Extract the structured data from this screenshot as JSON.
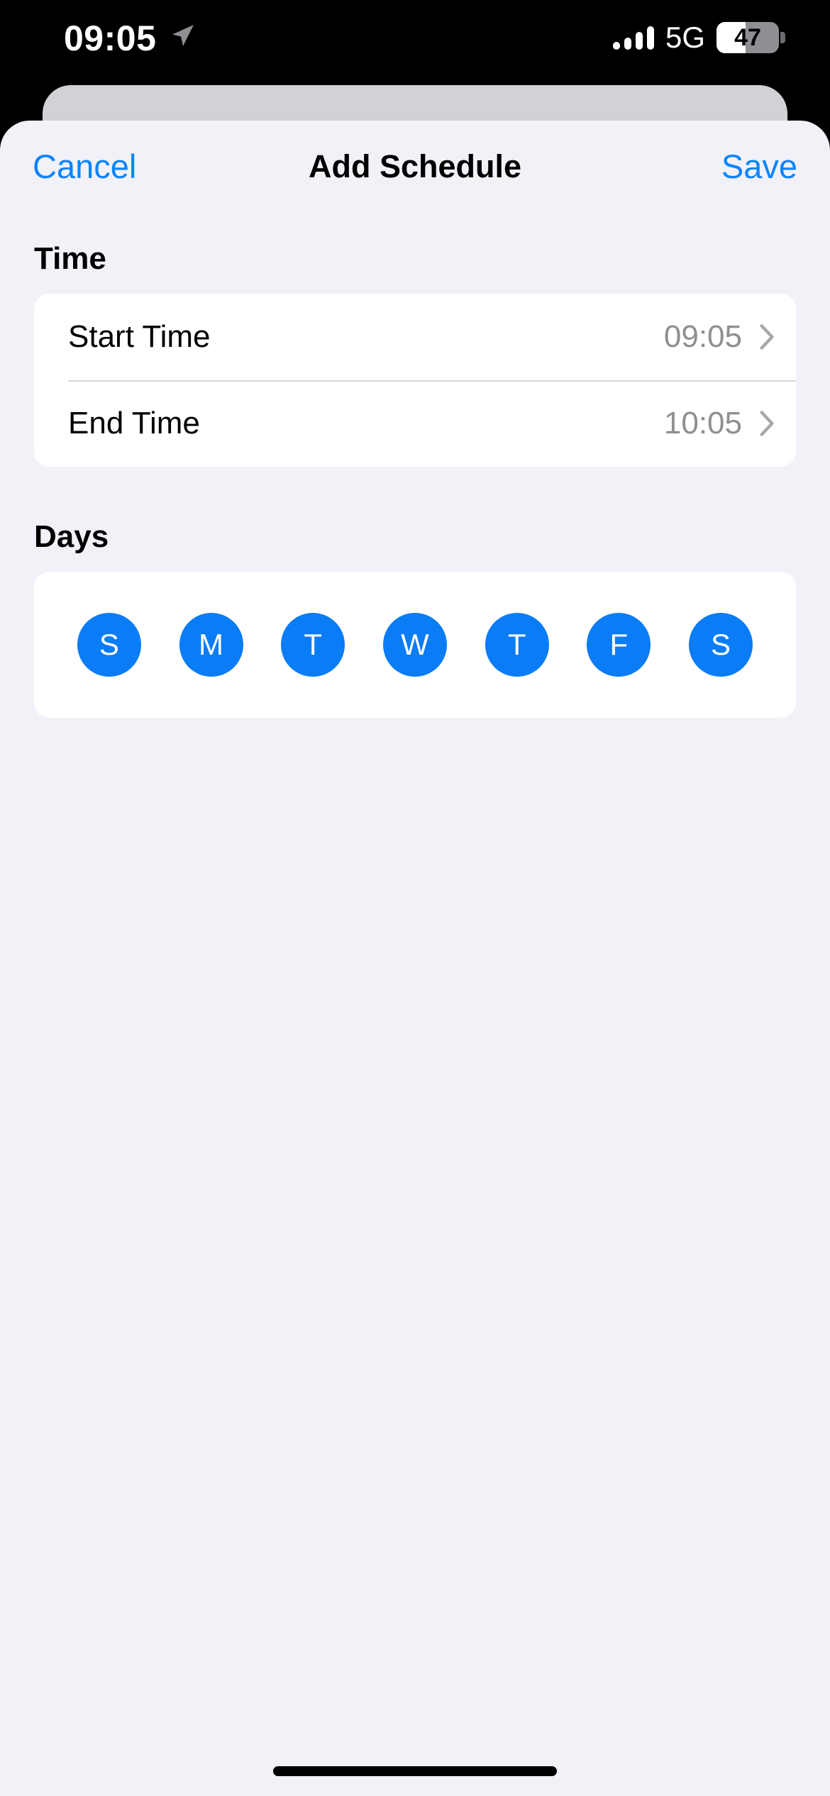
{
  "status_bar": {
    "time": "09:05",
    "location_icon": "location-arrow-icon",
    "signal_icon": "cellular-signal-icon",
    "signal_bars": 4,
    "network": "5G",
    "battery_level": "47",
    "battery_percent": 47
  },
  "nav": {
    "cancel_label": "Cancel",
    "title": "Add Schedule",
    "save_label": "Save"
  },
  "time_section": {
    "header": "Time",
    "rows": [
      {
        "label": "Start Time",
        "value": "09:05",
        "chevron": "chevron-right-icon"
      },
      {
        "label": "End Time",
        "value": "10:05",
        "chevron": "chevron-right-icon"
      }
    ]
  },
  "days_section": {
    "header": "Days",
    "days": [
      {
        "label": "S",
        "name": "sunday",
        "selected": true
      },
      {
        "label": "M",
        "name": "monday",
        "selected": true
      },
      {
        "label": "T",
        "name": "tuesday",
        "selected": true
      },
      {
        "label": "W",
        "name": "wednesday",
        "selected": true
      },
      {
        "label": "T",
        "name": "thursday",
        "selected": true
      },
      {
        "label": "F",
        "name": "friday",
        "selected": true
      },
      {
        "label": "S",
        "name": "saturday",
        "selected": true
      }
    ]
  },
  "colors": {
    "accent": "#0a84ff",
    "day_selected": "#0a7cf5",
    "sheet_background": "#f2f1f8",
    "card_background": "#ffffff",
    "secondary_text": "#8e8e93"
  }
}
